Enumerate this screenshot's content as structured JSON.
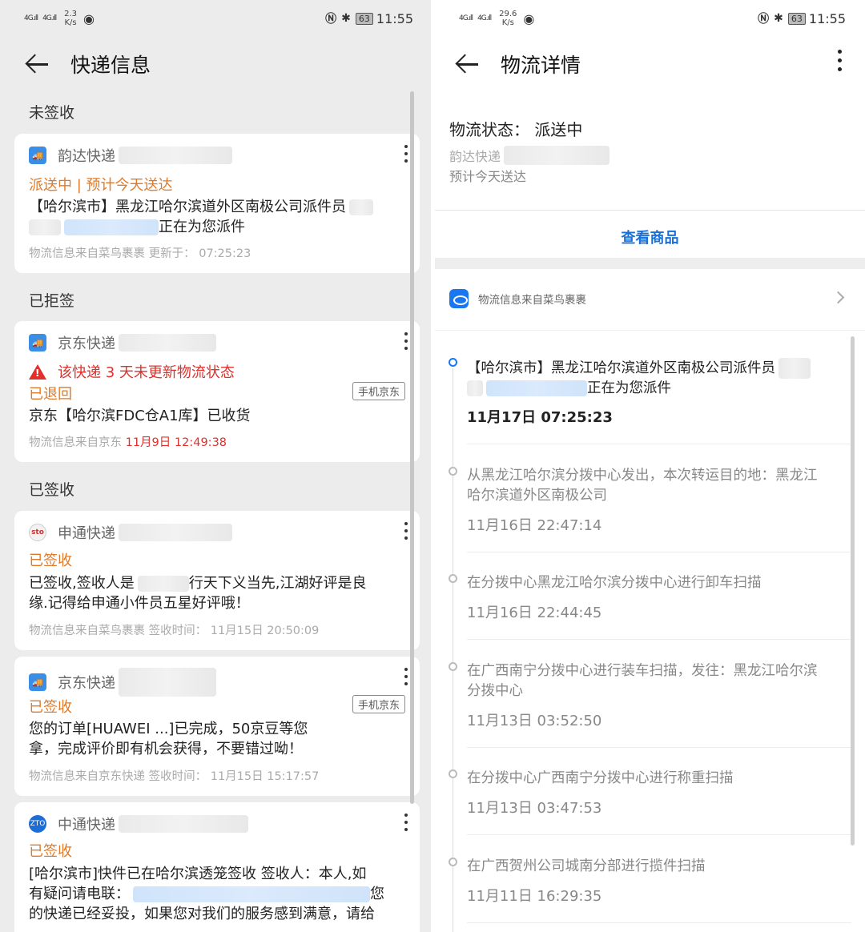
{
  "left": {
    "status_bar": {
      "signal1": "4G.ıll",
      "signal2": "4G.ıll",
      "speed": "2.3",
      "speed_unit": "K/s",
      "battery": "63",
      "time": "11:55"
    },
    "title": "快递信息",
    "sections": [
      {
        "label": "未签收"
      },
      {
        "label": "已拒签"
      },
      {
        "label": "已签收"
      }
    ],
    "cards": [
      {
        "carrier": "韵达快递",
        "status": "派送中 | 预计今天送达",
        "body_line1": "【哈尔滨市】黑龙江哈尔滨道外区南极公司派件员",
        "body_line2": "正在为您派件",
        "source": "物流信息来自菜鸟裹裹 更新于： 07:25:23"
      },
      {
        "carrier": "京东快递",
        "warning": "该快递 3 天未更新物流状态",
        "status": "已退回",
        "tag": "手机京东",
        "body": "京东【哈尔滨FDC仓A1库】已收货",
        "source_prefix": "物流信息来自京东 ",
        "source_time": "11月9日 12:49:38"
      },
      {
        "carrier": "申通快递",
        "status": "已签收",
        "body_line1_a": "已签收,签收人是",
        "body_line1_b": "行天下义当先,江湖好评是良",
        "body_line2": "缘.记得给申通小件员五星好评哦！",
        "source": "物流信息来自菜鸟裹裹 签收时间： 11月15日 20:50:09"
      },
      {
        "carrier": "京东快递",
        "status": "已签收",
        "tag": "手机京东",
        "body_line1": "您的订单[HUAWEI ...]已完成，50京豆等您",
        "body_line2": "拿，完成评价即有机会获得，不要错过呦！",
        "source": "物流信息来自京东快递 签收时间： 11月15日 15:17:57"
      },
      {
        "carrier": "中通快递",
        "status": "已签收",
        "body_line1": "[哈尔滨市]快件已在哈尔滨透笼签收 签收人：本人,如",
        "body_line2_a": "有疑问请电联：",
        "body_line2_b": "您",
        "body_line3": "的快递已经妥投，如果您对我们的服务感到满意，请给"
      }
    ]
  },
  "right": {
    "status_bar": {
      "signal1": "4G.ıll",
      "signal2": "4G.ıll",
      "speed": "29.6",
      "speed_unit": "K/s",
      "battery": "63",
      "time": "11:55"
    },
    "title": "物流详情",
    "logistics_status": "物流状态： 派送中",
    "carrier": "韵达快递",
    "eta": "预计今天送达",
    "view_goods": "查看商品",
    "source": "物流信息来自菜鸟裹裹",
    "timeline": [
      {
        "line1": "【哈尔滨市】黑龙江哈尔滨道外区南极公司派件员",
        "line2": "正在为您派件",
        "time": "11月17日 07:25:23"
      },
      {
        "line1": "从黑龙江哈尔滨分拨中心发出，本次转运目的地：黑龙江",
        "line2": "哈尔滨道外区南极公司",
        "time": "11月16日 22:47:14"
      },
      {
        "line1": "在分拨中心黑龙江哈尔滨分拨中心进行卸车扫描",
        "line2": "",
        "time": "11月16日 22:44:45"
      },
      {
        "line1": "在广西南宁分拨中心进行装车扫描，发往：黑龙江哈尔滨",
        "line2": "分拨中心",
        "time": "11月13日 03:52:50"
      },
      {
        "line1": "在分拨中心广西南宁分拨中心进行称重扫描",
        "line2": "",
        "time": "11月13日 03:47:53"
      },
      {
        "line1": "在广西贺州公司城南分部进行揽件扫描",
        "line2": "",
        "time": "11月11日 16:29:35"
      }
    ]
  },
  "colors": {
    "accent_blue": "#1a6fd4",
    "status_orange": "#e07a28",
    "warning_red": "#e0302b"
  }
}
